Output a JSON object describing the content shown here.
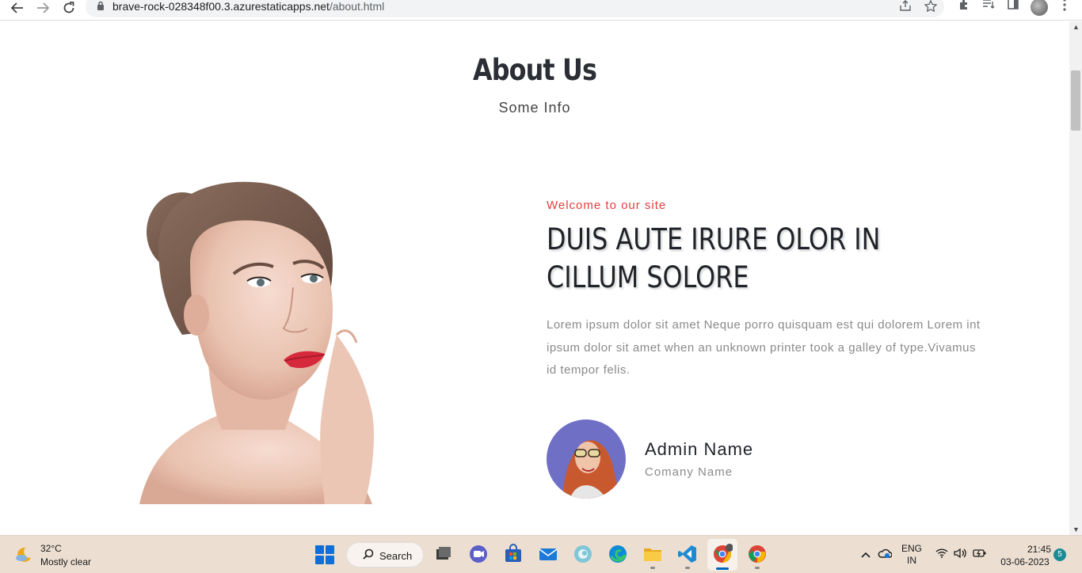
{
  "browser": {
    "url_host": "brave-rock-028348f00.3.azurestaticapps.net",
    "url_path": "/about.html",
    "icons": [
      "back-arrow-icon",
      "forward-arrow-icon",
      "reload-icon",
      "lock-icon",
      "share-icon",
      "star-icon",
      "extensions-icon",
      "reading-list-icon",
      "side-panel-icon",
      "profile-avatar",
      "menu-icon"
    ]
  },
  "page": {
    "title": "About Us",
    "subtitle": "Some Info",
    "kicker": "Welcome to our site",
    "headline_line1": "DUIS AUTE IRURE OLOR IN",
    "headline_line2": "CILLUM SOLORE",
    "paragraph": "Lorem ipsum dolor sit amet Neque porro quisquam est qui dolorem Lorem int ipsum dolor sit amet when an unknown printer took a galley of type.Vivamus id tempor felis.",
    "admin_name": "Admin Name",
    "company_name": "Comany Name",
    "colors": {
      "accent": "#e63d3d",
      "heading": "#1f2228",
      "body": "#8a8a8a"
    }
  },
  "taskbar": {
    "weather_temp": "32°C",
    "weather_condition": "Mostly clear",
    "search_label": "Search",
    "lang_top": "ENG",
    "lang_bottom": "IN",
    "time": "21:45",
    "date": "03-06-2023",
    "notifications": "5",
    "apps": [
      "task-view-icon",
      "teams-meet-icon",
      "microsoft-store-icon",
      "mail-icon",
      "edge-beta-icon",
      "edge-icon",
      "file-explorer-icon",
      "vscode-icon",
      "chrome-profile-icon",
      "chrome-icon"
    ]
  }
}
